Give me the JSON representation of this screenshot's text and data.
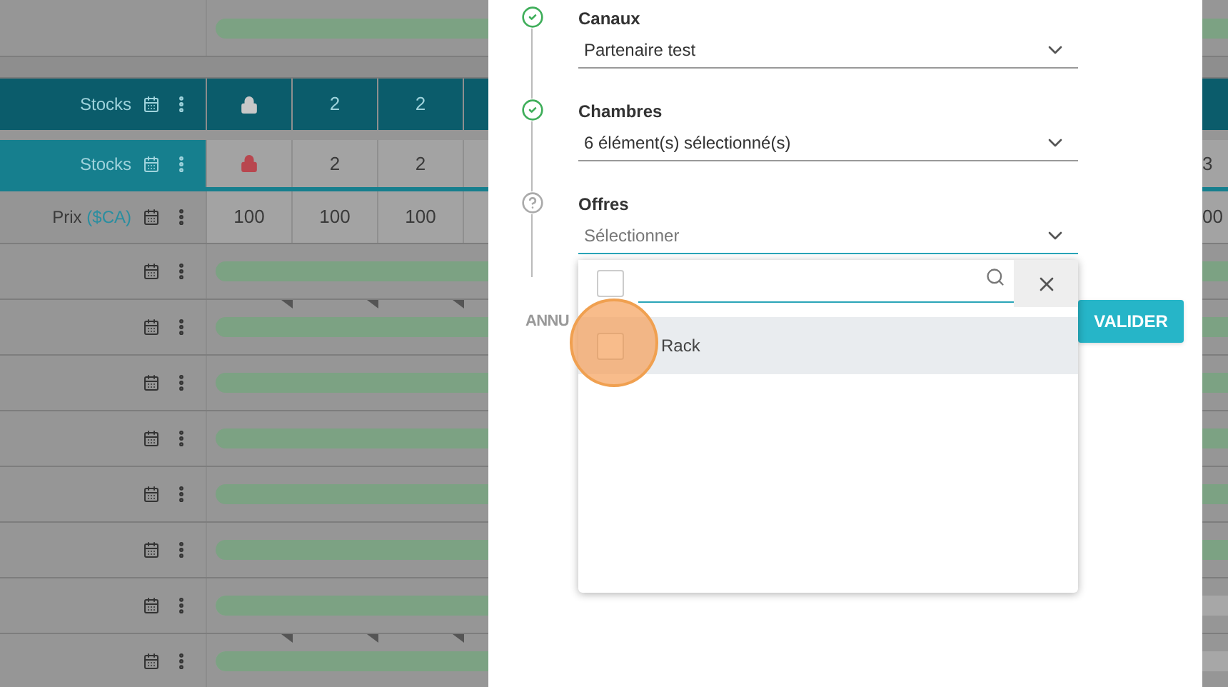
{
  "grid": {
    "rows": [
      {
        "kind": "top_bar",
        "level": 1
      },
      {
        "kind": "spacer"
      },
      {
        "kind": "stocks_header",
        "label": "Stocks",
        "cells": [
          {
            "kind": "lock"
          },
          {
            "kind": "text",
            "text": "2"
          },
          {
            "kind": "text",
            "text": "2"
          }
        ]
      },
      {
        "kind": "stocks",
        "label": "Stocks",
        "cells": [
          {
            "kind": "lock"
          },
          {
            "kind": "text",
            "text": "2"
          },
          {
            "kind": "text",
            "text": "2"
          }
        ],
        "edge": "3"
      },
      {
        "kind": "price",
        "label": "Prix",
        "currency": "($CA)",
        "cells": [
          {
            "kind": "text",
            "text": "100"
          },
          {
            "kind": "text",
            "text": "100"
          },
          {
            "kind": "text",
            "text": "100"
          }
        ],
        "edge": "00"
      },
      {
        "kind": "bar",
        "level": 1,
        "flagged": false
      },
      {
        "kind": "bar",
        "level": 1,
        "flagged": true
      },
      {
        "kind": "bar",
        "level": 1,
        "flagged": false
      },
      {
        "kind": "bar",
        "level": 1,
        "flagged": false
      },
      {
        "kind": "bar",
        "level": 1,
        "flagged": false
      },
      {
        "kind": "bar",
        "level": 1,
        "flagged": false
      },
      {
        "kind": "bar",
        "level": 0.6,
        "flagged": false
      },
      {
        "kind": "bar",
        "level": 0.6,
        "flagged": true
      }
    ]
  },
  "modal": {
    "steps": [
      {
        "kind": "done",
        "label": "Canaux",
        "value": "Partenaire test"
      },
      {
        "kind": "done",
        "label": "Chambres",
        "value": "6 élément(s) sélectionné(s)"
      },
      {
        "kind": "help",
        "label": "Offres",
        "placeholder": "Sélectionner",
        "expanded": true
      }
    ],
    "dropdown": {
      "select_all_checked": false,
      "options": [
        {
          "label": "Rack",
          "checked": false,
          "highlighted": true
        }
      ]
    },
    "cancel_button": "ANNU",
    "confirm_button": "VALIDER",
    "click_highlight": true
  }
}
